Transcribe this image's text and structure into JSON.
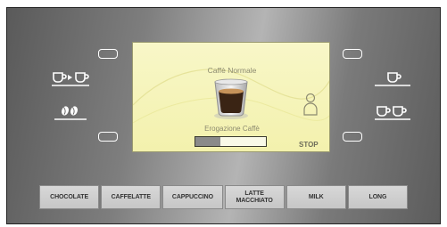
{
  "screen": {
    "title": "Caffè Normale",
    "progress_label": "Erogazione Caffè",
    "progress": 0.35,
    "stop_label": "STOP"
  },
  "left_icons": [
    "coffee-to-coffee-icon",
    "coffee-beans-icon"
  ],
  "right_icons": [
    "single-cup-icon",
    "double-cup-icon"
  ],
  "drink_buttons": [
    "CHOCOLATE",
    "CAFFELATTE",
    "CAPPUCCINO",
    "LATTE\nMACCHIATO",
    "MILK",
    "LONG"
  ],
  "colors": {
    "screen_bg": "#f3f1ad",
    "icon": "#ffffff",
    "button_bg": "#cfcfcf"
  }
}
